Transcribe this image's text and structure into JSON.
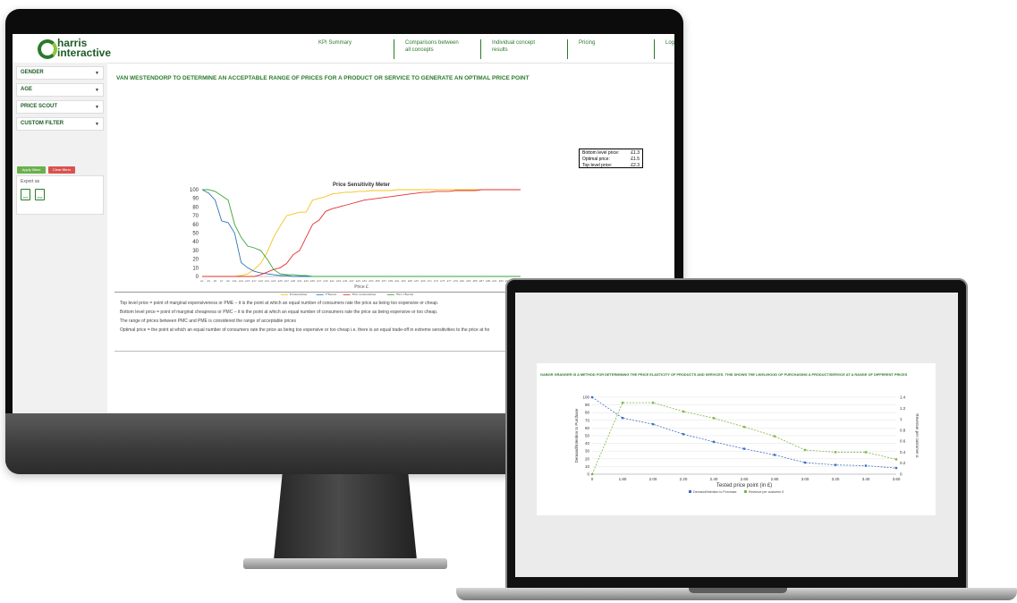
{
  "desktop": {
    "app": {
      "logo_line1": "harris",
      "logo_line2": "interactive",
      "nav": [
        {
          "line1": "KPI Summary",
          "line2": ""
        },
        {
          "line1": "Comparisons between",
          "line2": "all concepts"
        },
        {
          "line1": "Individual concept",
          "line2": "results"
        },
        {
          "line1": "Pricing",
          "line2": ""
        },
        {
          "line1": "Logout",
          "line2": ""
        }
      ]
    },
    "sidebar": {
      "filters": [
        "GENDER",
        "AGE",
        "PRICE SCOUT",
        "CUSTOM FILTER"
      ],
      "apply_label": "Apply filters",
      "clear_label": "Clear filters",
      "export_label": "Export as",
      "export_formats": [
        "PPT",
        "PDF"
      ]
    },
    "main": {
      "title": "VAN WESTENDORP TO DETERMINE AN ACCEPTABLE RANGE OF PRICES FOR A PRODUCT OR SERVICE TO GENERATE AN OPTIMAL PRICE POINT",
      "price_box": [
        {
          "label": "Bottom level price:",
          "value": "£1.3"
        },
        {
          "label": "Optimal price:",
          "value": "£1.5"
        },
        {
          "label": "Top level price:",
          "value": "£2.3"
        }
      ],
      "notes": [
        "Top level price = point of marginal expensiveness or PME – it is the point at which an equal number of consumers rate the price as being too expensive or cheap.",
        "Bottom level price = point of marginal cheapness or PMC – it is the point at which an equal number of consumers rate the price as being expensive or too cheap.",
        "The range of prices between PMC and PME is considered the range of acceptable prices",
        "Optimal price = the point at which an equal number of consumers rate the price as being too expensive or too cheap i.e. there is an equal trade-off in extreme sensitivities to the price at ho"
      ]
    }
  },
  "laptop": {
    "title": "GABOR GRANGER IS A METHOD FOR DETERMINING THE PRICE ELASTICITY OF PRODUCTS AND SERVICES. THIS SHOWS THE LIKELIHOOD OF PURCHASING A PRODUCT/SERVICE AT A RANGE OF DIFFERENT PRICES"
  },
  "colors": {
    "brand_green": "#2a7a2c",
    "expensive": "#f5c21b",
    "cheap": "#2e75b6",
    "too_expensive": "#e3302f",
    "too_cheap": "#3aa43a",
    "demand": "#3b6fc4",
    "revenue": "#7ab648",
    "apply_button": "#6ab04c",
    "clear_button": "#d9534f"
  },
  "chart_data": [
    {
      "type": "line",
      "title": "Price Sensitivity Meter",
      "xlabel": "Price £",
      "ylabel": "",
      "ylim": [
        0,
        100
      ],
      "yticks": [
        0,
        10,
        20,
        30,
        40,
        50,
        60,
        70,
        80,
        90,
        100
      ],
      "x": [
        "£1",
        "£3",
        "£5",
        "£7",
        "£9",
        "£11",
        "£13",
        "£15",
        "£17",
        "£19",
        "£21",
        "£23",
        "£25",
        "£27",
        "£29",
        "£31",
        "£33",
        "£35",
        "£37",
        "£39",
        "£41",
        "£43",
        "£45",
        "£47",
        "£49",
        "£51",
        "£53",
        "£55",
        "£57",
        "£59",
        "£61",
        "£63",
        "£65",
        "£67",
        "£69",
        "£71",
        "£73",
        "£75",
        "£77",
        "£79",
        "£81",
        "£83",
        "£85",
        "£87",
        "£89",
        "£91",
        "£93",
        "£95",
        "£97",
        "£99"
      ],
      "legend_position": "bottom",
      "series": [
        {
          "name": "Expensive",
          "values": [
            0,
            0,
            0,
            0,
            0,
            0,
            1,
            3,
            8,
            15,
            28,
            45,
            58,
            70,
            72,
            74,
            74,
            88,
            90,
            92,
            95,
            96,
            97,
            97,
            98,
            98,
            99,
            99,
            99,
            99,
            100,
            100,
            100,
            100,
            100,
            100,
            100,
            100,
            100,
            100,
            100,
            100,
            100,
            100,
            100,
            100,
            100,
            100,
            100,
            100
          ]
        },
        {
          "name": "Cheap",
          "values": [
            100,
            96,
            88,
            64,
            62,
            50,
            16,
            10,
            6,
            4,
            3,
            2,
            1,
            1,
            0,
            0,
            0,
            0,
            0,
            0,
            0,
            0,
            0,
            0,
            0,
            0,
            0,
            0,
            0,
            0,
            0,
            0,
            0,
            0,
            0,
            0,
            0,
            0,
            0,
            0,
            0,
            0,
            0,
            0,
            0,
            0,
            0,
            0,
            0,
            0
          ]
        },
        {
          "name": "Too expensive",
          "values": [
            0,
            0,
            0,
            0,
            0,
            0,
            0,
            0,
            0,
            2,
            5,
            8,
            10,
            15,
            25,
            30,
            45,
            60,
            65,
            75,
            78,
            80,
            82,
            84,
            86,
            88,
            89,
            90,
            91,
            92,
            93,
            94,
            95,
            96,
            97,
            97,
            98,
            98,
            98,
            99,
            99,
            99,
            99,
            100,
            100,
            100,
            100,
            100,
            100,
            100
          ]
        },
        {
          "name": "Too cheap",
          "values": [
            100,
            100,
            98,
            93,
            88,
            60,
            45,
            35,
            33,
            30,
            20,
            8,
            3,
            2,
            2,
            1,
            1,
            0,
            0,
            0,
            0,
            0,
            0,
            0,
            0,
            0,
            0,
            0,
            0,
            0,
            0,
            0,
            0,
            0,
            0,
            0,
            0,
            0,
            0,
            0,
            0,
            0,
            0,
            0,
            0,
            0,
            0,
            0,
            0,
            0
          ]
        }
      ]
    },
    {
      "type": "line",
      "title": "",
      "xlabel": "Tested price point (in £)",
      "ylabel": "Demand/Intention to Purchase",
      "ylabel_right": "Revenue per customer £",
      "categories": [
        "0",
        "1.80",
        "2.00",
        "2.20",
        "2.40",
        "2.60",
        "2.80",
        "3.00",
        "3.20",
        "3.40",
        "3.60"
      ],
      "ylim": [
        0,
        100
      ],
      "yticks": [
        0,
        10,
        20,
        30,
        40,
        50,
        60,
        70,
        80,
        90,
        100
      ],
      "y2lim": [
        0,
        1.4
      ],
      "y2ticks": [
        "0",
        "0.2",
        "0.4",
        "0.6",
        "0.8",
        "1",
        "1.2",
        "1.4"
      ],
      "legend_position": "bottom",
      "series": [
        {
          "name": "Demand/Intention to Purchase",
          "axis": "left",
          "values": [
            100,
            73,
            65,
            52,
            42,
            33,
            25,
            15,
            12,
            11,
            8
          ]
        },
        {
          "name": "Revenue per customer £",
          "axis": "right",
          "values": [
            0,
            1.3,
            1.3,
            1.14,
            1.02,
            0.86,
            0.69,
            0.44,
            0.4,
            0.4,
            0.27
          ]
        }
      ]
    }
  ]
}
